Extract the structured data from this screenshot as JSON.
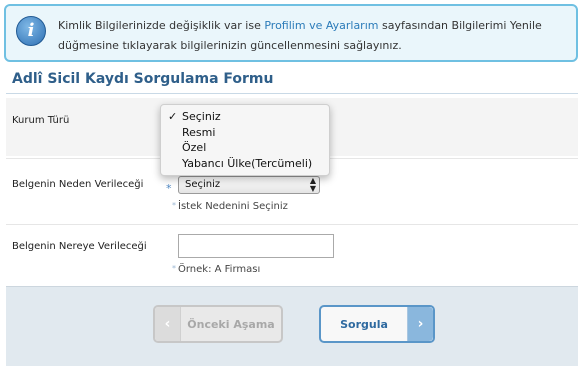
{
  "info": {
    "text_before": "Kimlik Bilgilerinizde değişiklik var ise ",
    "link": "Profilim ve Ayarlarım",
    "text_after": " sayfasından Bilgilerimi Yenile düğmesine tıklayarak bilgilerinizin güncellenmesini sağlayınız.",
    "icon": "info-icon"
  },
  "form": {
    "title": "Adlî Sicil Kaydı Sorgulama Formu",
    "fields": {
      "kurum": {
        "label": "Kurum Türü"
      },
      "neden": {
        "label": "Belgenin Neden Verileceği",
        "value": "Seçiniz",
        "hint": "İstek Nedenini Seçiniz",
        "required_mark": "*"
      },
      "nereye": {
        "label": "Belgenin Nereye Verileceği",
        "value": "",
        "hint": "Örnek: A Firması"
      }
    }
  },
  "dropdown": {
    "check": "✓",
    "options": [
      "Seçiniz",
      "Resmi",
      "Özel",
      "Yabancı Ülke(Tercümeli)"
    ],
    "selected": "Seçiniz"
  },
  "footer": {
    "prev_label": "Önceki Aşama",
    "next_label": "Sorgula",
    "prev_icon": "chevron-left-icon",
    "next_icon": "chevron-right-icon"
  },
  "colors": {
    "info_border": "#6fc0e2",
    "title": "#2f5f8a",
    "accent": "#5a96c8"
  }
}
